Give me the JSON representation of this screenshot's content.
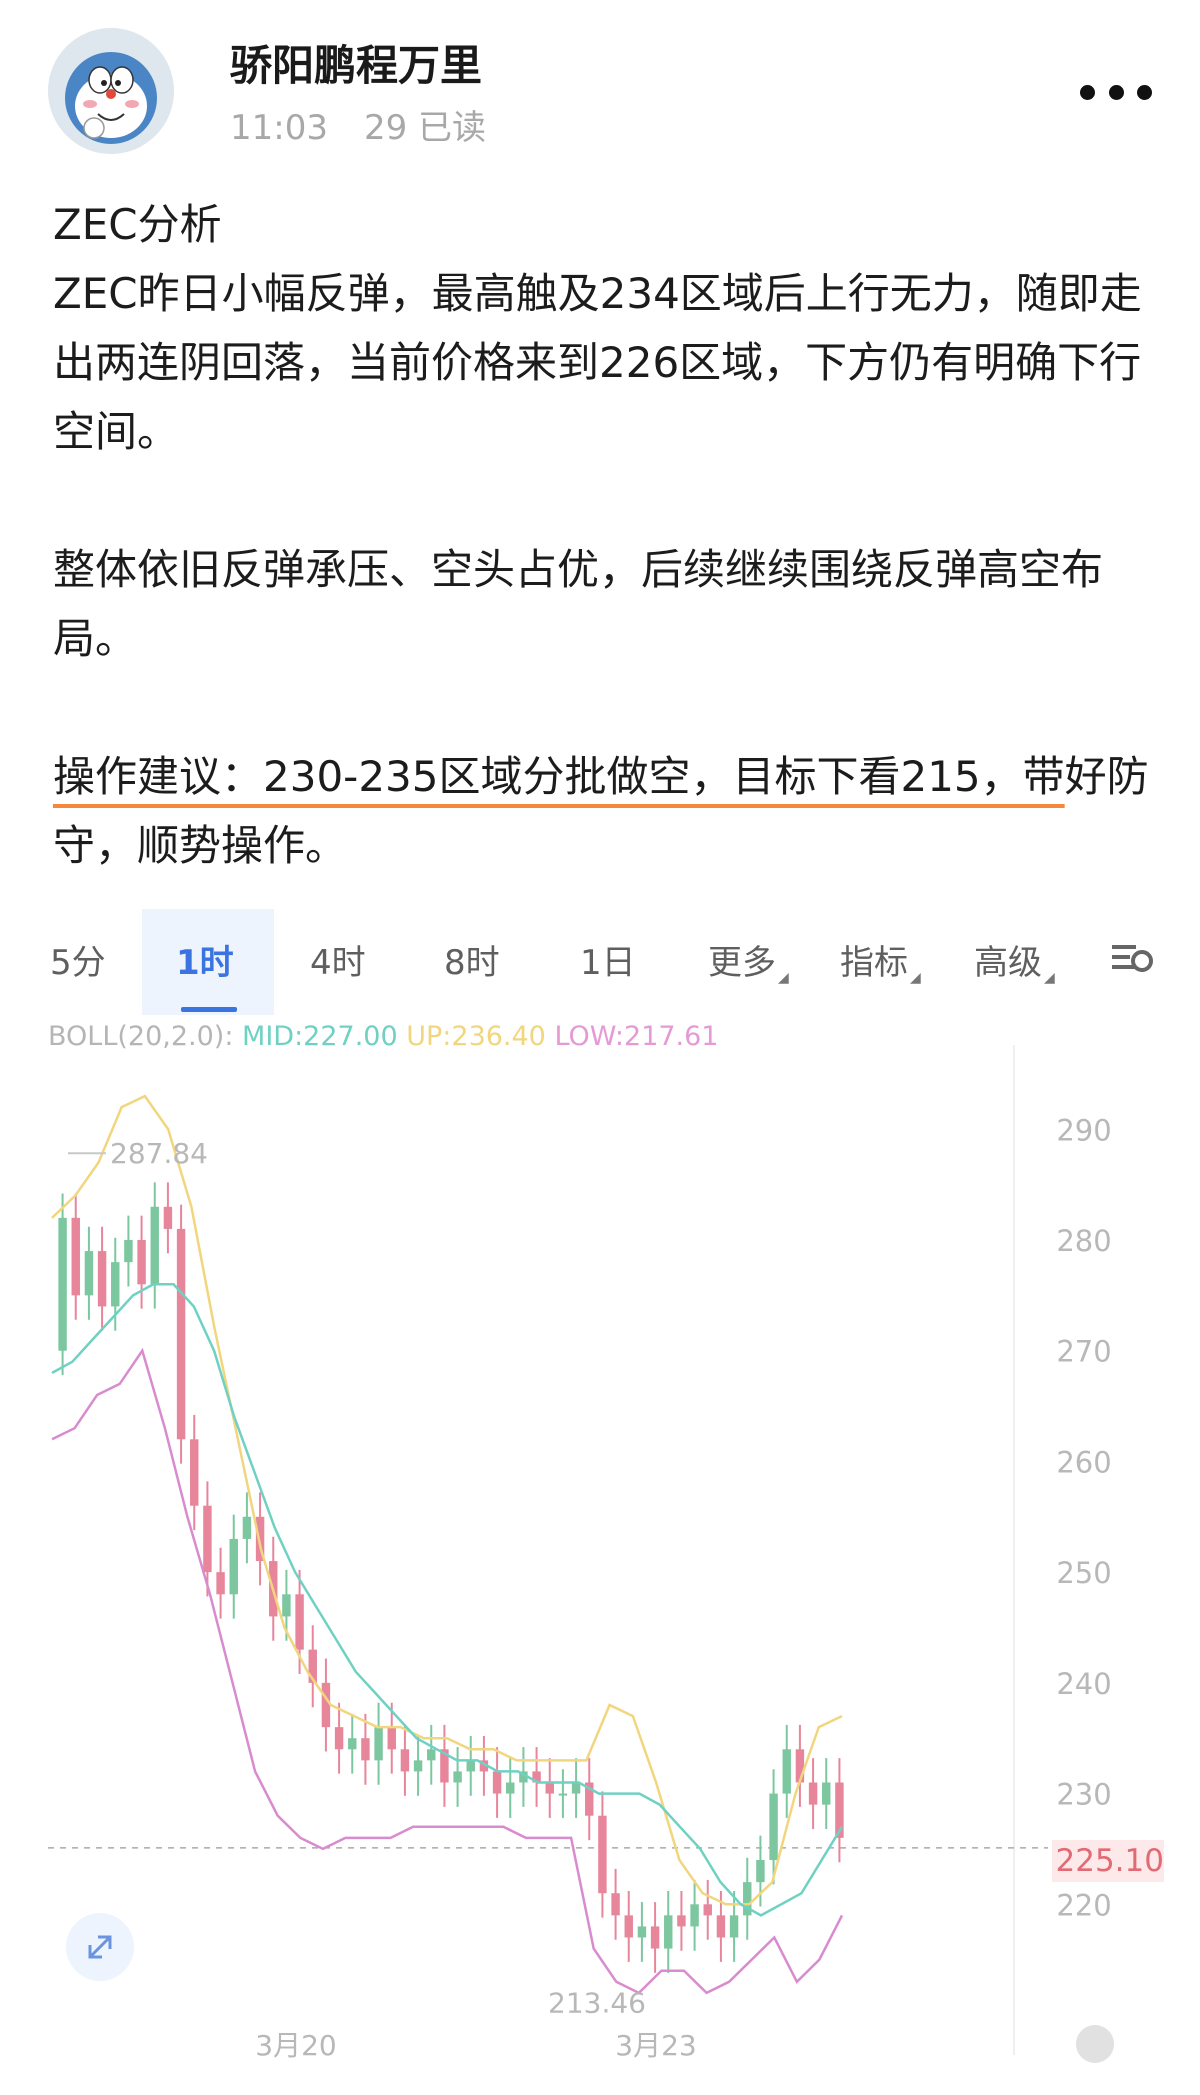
{
  "author": {
    "name": "骄阳鹏程万里",
    "time": "11:03",
    "reads": "29 已读"
  },
  "post": {
    "title": "ZEC分析",
    "p1": "ZEC昨日小幅反弹，最高触及234区域后上行无力，随即走出两连阴回落，当前价格来到226区域，下方仍有明确下行空间。",
    "p2": "整体依旧反弹承压、空头占优，后续继续围绕反弹高空布局。",
    "p3_underlined": "操作建议：230-235区域分批做空，目标下看215，带",
    "p3_rest": "好防守，顺势操作。"
  },
  "chart_tabs": [
    "5分",
    "1时",
    "4时",
    "8时",
    "1日",
    "更多",
    "指标",
    "高级"
  ],
  "chart_tabs_active": "1时",
  "indicator": {
    "name": "BOLL(20,2.0):",
    "mid": "MID:227.00",
    "up": "UP:236.40",
    "low": "LOW:217.61"
  },
  "chart_data": {
    "type": "candlestick",
    "y_ticks": [
      290,
      280,
      270,
      260,
      250,
      240,
      230,
      220
    ],
    "ylim": [
      210,
      294
    ],
    "x_ticks": [
      "3月20",
      "3月23"
    ],
    "current_price": "225.10",
    "annotations": {
      "high": "287.84",
      "low": "213.46"
    },
    "colors": {
      "up": "#7cc79f",
      "down": "#e7869b",
      "mid": "#6fd1c3",
      "upper": "#f1d67e",
      "lower": "#d98bcf",
      "active": "#3b74e0"
    },
    "close_series": [
      282,
      275,
      279,
      274,
      278,
      280,
      276,
      283,
      281,
      262,
      256,
      250,
      248,
      253,
      255,
      251,
      246,
      248,
      243,
      240,
      236,
      234,
      235,
      233,
      236,
      234,
      232,
      233,
      234,
      231,
      232,
      233,
      232,
      230,
      231,
      232,
      231,
      230,
      230,
      231,
      228,
      221,
      219,
      217,
      218,
      216,
      219,
      218,
      220,
      219,
      217,
      219,
      222,
      224,
      230,
      234,
      231,
      229,
      231,
      226
    ],
    "mid_series": [
      268,
      269,
      271,
      273,
      275,
      276,
      276,
      274,
      270,
      264,
      259,
      254,
      250,
      247,
      244,
      241,
      239,
      237,
      235,
      234,
      233,
      233,
      232,
      232,
      231,
      231,
      231,
      230,
      230,
      230,
      229,
      227,
      225,
      222,
      220,
      219,
      220,
      221,
      224,
      227
    ],
    "upper_series": [
      282,
      284,
      287,
      292,
      293,
      290,
      283,
      272,
      262,
      252,
      245,
      241,
      238,
      237,
      236,
      236,
      235,
      235,
      234,
      234,
      233,
      233,
      233,
      233,
      238,
      237,
      231,
      224,
      221,
      220,
      220,
      222,
      230,
      236,
      237
    ],
    "lower_series": [
      262,
      263,
      266,
      267,
      270,
      263,
      255,
      248,
      240,
      232,
      228,
      226,
      225,
      226,
      226,
      226,
      227,
      227,
      227,
      227,
      227,
      226,
      226,
      226,
      216,
      213,
      212,
      214,
      214,
      212,
      213,
      215,
      217,
      213,
      215,
      219
    ]
  }
}
